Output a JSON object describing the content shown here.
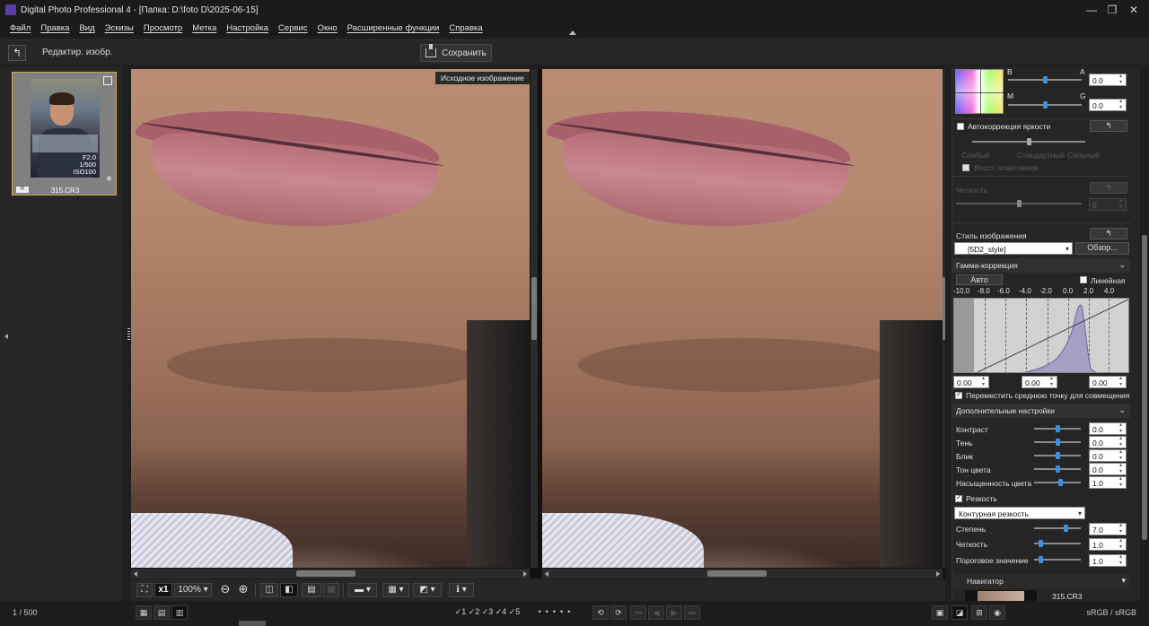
{
  "window": {
    "title": "Digital Photo Professional 4 - [Папка: D:\\foto D\\2025-06-15]",
    "minimize": "—",
    "maximize": "❐",
    "close": "✕"
  },
  "menu": [
    "Файл",
    "Правка",
    "Вид",
    "Эскизы",
    "Просмотр",
    "Метка",
    "Настройка",
    "Сервис",
    "Окно",
    "Расширенные функции",
    "Справка"
  ],
  "toolbar": {
    "back_icon": "↰",
    "mode_label": "Редактир. изобр.",
    "save_label": "Сохранить"
  },
  "thumbnail": {
    "info_lines": [
      "F2.0",
      "1/500",
      "ISO100"
    ],
    "badge": "R",
    "filename": "315.CR3",
    "check": "❄"
  },
  "viewer": {
    "original_label": "Исходное изображение"
  },
  "view_tools": {
    "zoom_x1": "x1",
    "zoom_level": "100%",
    "zoom_out": "⊖",
    "zoom_in": "⊕"
  },
  "statusbar": {
    "page_count": "1 / 500",
    "ratings": [
      "1",
      "2",
      "3",
      "4",
      "5"
    ],
    "colorspace": "sRGB / sRGB"
  },
  "palette": {
    "wb": {
      "label_b": "B",
      "label_a": "A",
      "label_m": "M",
      "label_g": "G",
      "ba_value": "0.0",
      "mg_value": "0.0",
      "ba_level": 0.5,
      "mg_level": 0.5
    },
    "auto_brightness": {
      "label": "Автокоррекция яркости",
      "reset": "↰",
      "levels": [
        "Слабый",
        "Стандартный",
        "Сильный"
      ],
      "restore_label": "Восст. осветления",
      "level": 0.5
    },
    "clarity": {
      "label": "Четкость",
      "value": "0",
      "reset": "↰",
      "level": 0.5
    },
    "picture_style": {
      "label": "Стиль изображения",
      "reset": "↰",
      "selected": "[5D2_style]",
      "browse": "Обзор..."
    },
    "gamma": {
      "section": "Гамма-коррекция",
      "auto": "Авто",
      "linear": "Линейная",
      "ticks": [
        "-10.0",
        "-8.0",
        "-6.0",
        "-4.0",
        "-2.0",
        "0.0",
        "2.0",
        "4.0"
      ],
      "low": "0.00",
      "mid": "0.00",
      "high": "0.00",
      "move_mid_label": "Переместить среднюю точку для совмещения"
    },
    "advanced": {
      "section": "Дополнительные настройки",
      "rows": [
        {
          "label": "Контраст",
          "value": "0.0",
          "level": 0.5
        },
        {
          "label": "Тень",
          "value": "0.0",
          "level": 0.5
        },
        {
          "label": "Блик",
          "value": "0.0",
          "level": 0.5
        },
        {
          "label": "Тон цвета",
          "value": "0.0",
          "level": 0.5
        },
        {
          "label": "Насыщенность цвета",
          "value": "1.0",
          "level": 0.58
        }
      ]
    },
    "sharpness": {
      "label": "Резкость",
      "mode": "Контурная резкость",
      "rows": [
        {
          "label": "Степень",
          "value": "7.0",
          "level": 0.7
        },
        {
          "label": "Четкость",
          "value": "1.0",
          "level": 0.1
        },
        {
          "label": "Пороговое значение",
          "value": "1.0",
          "level": 0.1
        }
      ]
    },
    "navigator": {
      "section": "Навигатор",
      "filename": "315.CR3"
    }
  }
}
